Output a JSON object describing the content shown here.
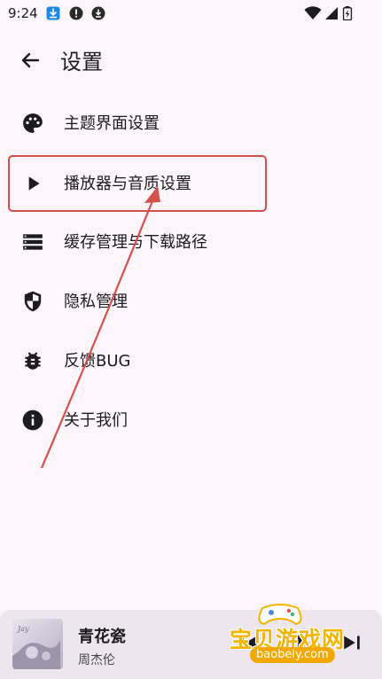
{
  "status_bar": {
    "time": "9:24",
    "icons": [
      "download-icon",
      "alert-icon",
      "download-circle-icon",
      "wifi-icon",
      "signal-icon",
      "battery-icon"
    ]
  },
  "app_bar": {
    "title": "设置",
    "back_icon": "arrow-left-icon"
  },
  "menu": {
    "items": [
      {
        "label": "主题界面设置",
        "icon": "palette-icon"
      },
      {
        "label": "播放器与音质设置",
        "icon": "play-icon"
      },
      {
        "label": "缓存管理与下载路径",
        "icon": "storage-list-icon"
      },
      {
        "label": "隐私管理",
        "icon": "shield-icon"
      },
      {
        "label": "反馈BUG",
        "icon": "bug-icon"
      },
      {
        "label": "关于我们",
        "icon": "info-icon"
      }
    ]
  },
  "annotation": {
    "color": "#D3514A"
  },
  "mini_player": {
    "title": "青花瓷",
    "artist": "周杰伦",
    "controls": [
      "previous-icon",
      "play-pause-icon",
      "next-icon"
    ]
  },
  "watermark": {
    "text": "宝贝游戏网",
    "url": "baobeiy.com"
  },
  "colors": {
    "background": "#FCF6FB",
    "text": "#1C1B1F",
    "player_background": "#EDE6EE",
    "watermark": "#F5B400"
  }
}
